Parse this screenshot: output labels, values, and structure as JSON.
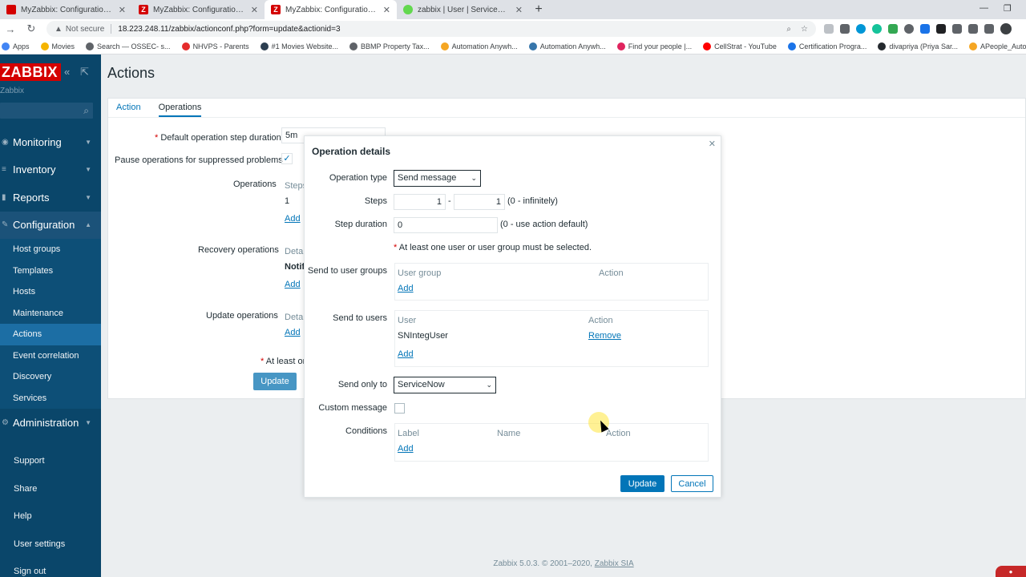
{
  "browser": {
    "tabs": [
      {
        "title": "MyZabbix: Configuration of temp",
        "icon_color": "#d40000",
        "active": false
      },
      {
        "title": "MyZabbix: Configuration of host",
        "icon_color": "#d40000",
        "active": false
      },
      {
        "title": "MyZabbix: Configuration of actio",
        "icon_color": "#d40000",
        "active": true
      },
      {
        "title": "zabbix | User | ServiceNow",
        "icon_color": "#62d84e",
        "active": false
      }
    ],
    "new_tab": "+",
    "not_secure": "Not secure",
    "url": "18.223.248.11/zabbix/actionconf.php?form=update&actionid=3",
    "bookmarks": [
      {
        "label": "Apps",
        "color": "#4285f4"
      },
      {
        "label": "Movies",
        "color": "#f5b400"
      },
      {
        "label": "Search — OSSEC- s...",
        "color": "#5f6368"
      },
      {
        "label": "NHVPS - Parents",
        "color": "#e52c2c"
      },
      {
        "label": "#1 Movies Website...",
        "color": "#2c3e50"
      },
      {
        "label": "BBMP Property Tax...",
        "color": "#5f6368"
      },
      {
        "label": "Automation Anywh...",
        "color": "#f5a623"
      },
      {
        "label": "Automation Anywh...",
        "color": "#3776ab"
      },
      {
        "label": "Find your people |...",
        "color": "#e0245e"
      },
      {
        "label": "CellStrat - YouTube",
        "color": "#ff0000"
      },
      {
        "label": "Certification Progra...",
        "color": "#1a73e8"
      },
      {
        "label": "divapriya (Priya Sar...",
        "color": "#24292e"
      },
      {
        "label": "APeople_Automatio...",
        "color": "#f5a623"
      }
    ]
  },
  "sidebar": {
    "logo": "ZABBIX",
    "server_name": "Zabbix",
    "menu": [
      {
        "label": "Monitoring",
        "icon": "eye-icon"
      },
      {
        "label": "Inventory",
        "icon": "list-icon"
      },
      {
        "label": "Reports",
        "icon": "chart-icon"
      },
      {
        "label": "Configuration",
        "icon": "wrench-icon"
      }
    ],
    "config_items": [
      "Host groups",
      "Templates",
      "Hosts",
      "Maintenance",
      "Actions",
      "Event correlation",
      "Discovery",
      "Services"
    ],
    "admin_label": "Administration",
    "bottom_items": [
      "Support",
      "Share",
      "Help",
      "User settings",
      "Sign out"
    ]
  },
  "page": {
    "title": "Actions",
    "tabs": [
      "Action",
      "Operations"
    ],
    "default_step_label": "Default operation step duration",
    "default_step_value": "5m",
    "pause_label": "Pause operations for suppressed problems",
    "operations_label": "Operations",
    "steps_head": "Steps",
    "step_one": "1",
    "add": "Add",
    "recovery_label": "Recovery operations",
    "details_head": "Detai",
    "notif": "Notif",
    "update_ops_label": "Update operations",
    "at_least": "At least on",
    "update_btn": "Update",
    "footer_text": "Zabbix 5.0.3. © 2001–2020,",
    "footer_link": "Zabbix SIA"
  },
  "modal": {
    "title": "Operation details",
    "op_type_label": "Operation type",
    "op_type_value": "Send message",
    "steps_label": "Steps",
    "steps_from": "1",
    "steps_to": "1",
    "steps_dash": "-",
    "steps_hint": "(0 - infinitely)",
    "duration_label": "Step duration",
    "duration_value": "0",
    "duration_hint": "(0 - use action default)",
    "required_note": "At least one user or user group must be selected.",
    "groups_label": "Send to user groups",
    "groups_col1": "User group",
    "groups_col2": "Action",
    "add": "Add",
    "users_label": "Send to users",
    "users_col1": "User",
    "users_col2": "Action",
    "user_name": "SNIntegUser",
    "remove": "Remove",
    "send_only_label": "Send only to",
    "send_only_value": "ServiceNow",
    "custom_label": "Custom message",
    "conditions_label": "Conditions",
    "cond_col1": "Label",
    "cond_col2": "Name",
    "cond_col3": "Action",
    "update_btn": "Update",
    "cancel_btn": "Cancel"
  }
}
